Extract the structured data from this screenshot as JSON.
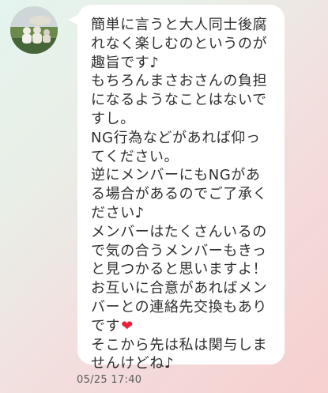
{
  "message": {
    "lines": [
      "簡単に言うと大人同士後腐",
      "れなく楽しむのというのが",
      "趣旨です♪",
      "もちろんまさおさんの負担",
      "になるようなことはないで",
      "すし。",
      "NG行為などがあれば仰っ",
      "てください。",
      "逆にメンバーにもNGがあ",
      "る場合があるのでご了承く",
      "ださい♪",
      "メンバーはたくさんいるの",
      "で気の合うメンバーもきっ",
      "と見つかると思いますよ！",
      "お互いに合意があればメン",
      "バーとの連絡先交換もあり",
      "です",
      "そこから先は私は関与しま",
      "せんけどね♪"
    ],
    "heart_emoji": "❤",
    "timestamp": "05/25 17:40"
  },
  "colors": {
    "bubble": "#ffffff",
    "text": "#2f2f2f",
    "heart": "#e8203a",
    "timestamp": "#5c5c5c"
  },
  "icons": {
    "avatar": "profile-photo"
  }
}
